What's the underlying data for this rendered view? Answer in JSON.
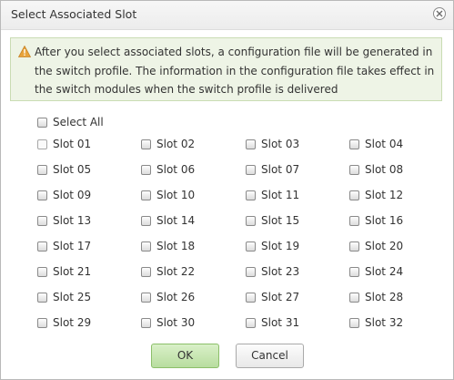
{
  "dialog": {
    "title": "Select Associated Slot",
    "notice": "After you select associated slots, a configuration file will be generated in the switch profile. The information in the configuration file takes effect in the switch modules when the switch profile is delivered",
    "select_all_label": "Select All",
    "slots": [
      "Slot 01",
      "Slot 02",
      "Slot 03",
      "Slot 04",
      "Slot 05",
      "Slot 06",
      "Slot 07",
      "Slot 08",
      "Slot 09",
      "Slot 10",
      "Slot 11",
      "Slot 12",
      "Slot 13",
      "Slot 14",
      "Slot 15",
      "Slot 16",
      "Slot 17",
      "Slot 18",
      "Slot 19",
      "Slot 20",
      "Slot 21",
      "Slot 22",
      "Slot 23",
      "Slot 24",
      "Slot 25",
      "Slot 26",
      "Slot 27",
      "Slot 28",
      "Slot 29",
      "Slot 30",
      "Slot 31",
      "Slot 32"
    ],
    "ok_label": "OK",
    "cancel_label": "Cancel"
  },
  "colors": {
    "notice_bg": "#eef4e6",
    "warning_icon": "#e8a33a",
    "ok_button": "#b8dd9f"
  }
}
